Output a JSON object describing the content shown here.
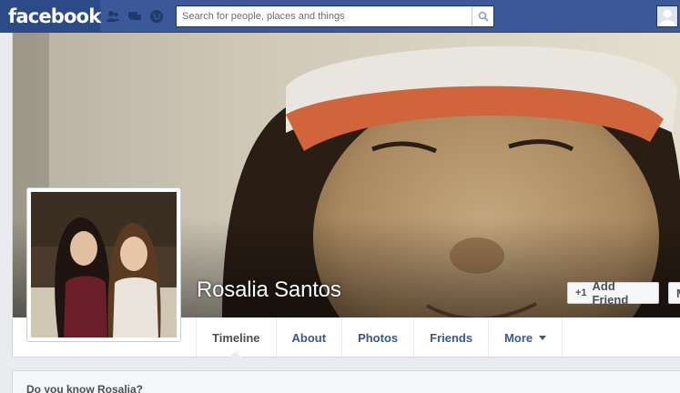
{
  "topbar": {
    "logo": "facebook",
    "search_placeholder": "Search for people, places and things",
    "icons": [
      "friend-requests-icon",
      "messages-icon",
      "notifications-icon",
      "search-icon",
      "profile-avatar"
    ]
  },
  "profile": {
    "name": "Rosalia Santos",
    "add_friend_label": "Add Friend",
    "message_label": "M"
  },
  "tabs": [
    {
      "label": "Timeline",
      "active": true
    },
    {
      "label": "About",
      "active": false
    },
    {
      "label": "Photos",
      "active": false
    },
    {
      "label": "Friends",
      "active": false
    },
    {
      "label": "More",
      "active": false
    }
  ],
  "know_box": {
    "title": "Do you know Rosalia?"
  },
  "colors": {
    "brand_blue": "#3b5998",
    "link_blue": "#365899",
    "background": "#e9ebee"
  }
}
